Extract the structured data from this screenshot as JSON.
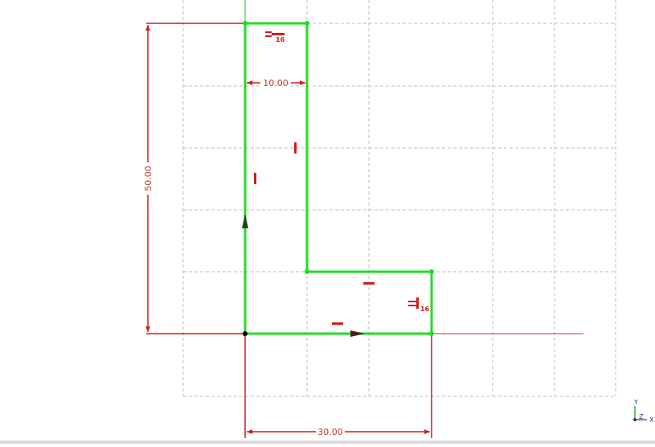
{
  "sketch": {
    "dimensions": {
      "top_width": "10.00",
      "height": "50.00",
      "bottom_width": "30.00"
    },
    "constraint_labels": {
      "top_equal_index": "16",
      "right_equal_index": "16"
    },
    "axes": {
      "x": "X",
      "y": "Y",
      "z": "Z"
    },
    "colors": {
      "geometry": "#22dd22",
      "constraint": "#d41b1b",
      "dimension": "#c0392b",
      "grid": "#bdbdbd",
      "axis_x": "#c0392b",
      "axis_y": "#2db32d"
    }
  }
}
